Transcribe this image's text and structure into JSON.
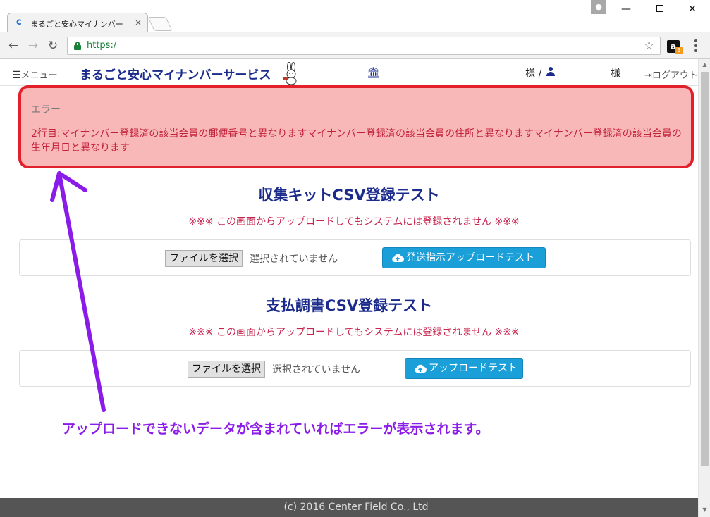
{
  "browser": {
    "tab_title": "まるごと安心マイナンバー",
    "tab_close": "×",
    "url": "https:/",
    "window_min": "—",
    "window_close": "✕",
    "nav_back": "←",
    "nav_forward": "→",
    "nav_reload": "↻",
    "star": "☆",
    "amazon_letter": "a",
    "amazon_badge": "3",
    "tab_favicon_letter": "c"
  },
  "header": {
    "menu_label": "メニュー",
    "menu_bars": "☰",
    "brand": "まるごと安心マイナンバーサービス",
    "bank_glyph": "🏛",
    "user_suffix": "様 /",
    "user_suffix2": "様",
    "logout_label": "ログアウト",
    "logout_glyph": "⇥"
  },
  "error": {
    "heading": "エラー",
    "message": "2行目:マイナンバー登録済の該当会員の郵便番号と異なりますマイナンバー登録済の該当会員の住所と異なりますマイナンバー登録済の該当会員の生年月日と異なります"
  },
  "sections": [
    {
      "title": "収集キットCSV登録テスト",
      "warning": "※※※ この画面からアップロードしてもシステムには登録されません ※※※",
      "file_button": "ファイルを選択",
      "file_status": "選択されていません",
      "upload_label": "発送指示アップロードテスト"
    },
    {
      "title": "支払調書CSV登録テスト",
      "warning": "※※※ この画面からアップロードしてもシステムには登録されません ※※※",
      "file_button": "ファイルを選択",
      "file_status": "選択されていません",
      "upload_label": "アップロードテスト"
    }
  ],
  "annotation": {
    "text": "アップロードできないデータが含まれていればエラーが表示されます。",
    "color": "#8b1be8"
  },
  "footer": {
    "text": "(c) 2016 Center Field Co., Ltd"
  },
  "colors": {
    "brand": "#1b2b8c",
    "alert_border": "#e2202c",
    "alert_bg": "#f9b8b8",
    "warning_text": "#c7254e",
    "upload_button": "#1a9fd9"
  }
}
